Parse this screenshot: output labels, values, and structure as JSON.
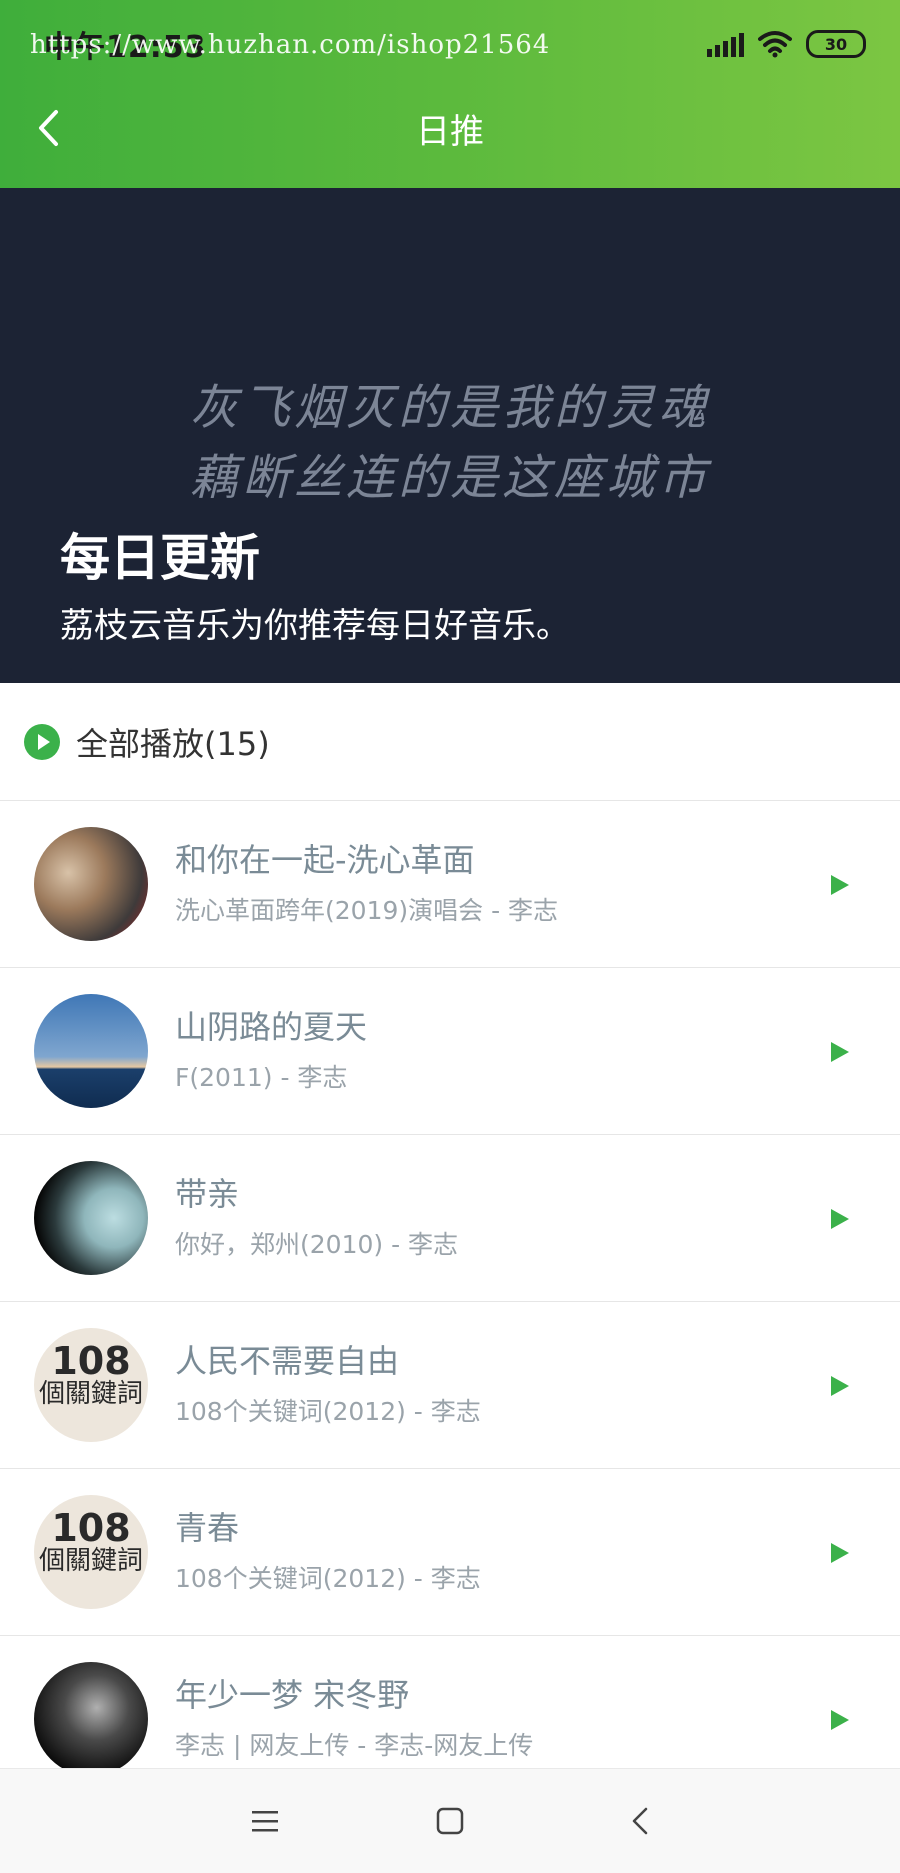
{
  "status_bar": {
    "time": "中午12:53",
    "watermark": "https://www.huzhan.com/ishop21564",
    "battery": "30",
    "icons": [
      "signal-icon",
      "wifi-icon",
      "battery-icon"
    ]
  },
  "header": {
    "title": "日推",
    "back_icon": "chevron-left-icon"
  },
  "banner": {
    "lyric_line_1": "灰飞烟灭的是我的灵魂",
    "lyric_line_2": "藕断丝连的是这座城市",
    "title": "每日更新",
    "subtitle": "荔枝云音乐为你推荐每日好音乐。"
  },
  "play_all": {
    "label": "全部播放(15)",
    "icon": "play-circle-icon"
  },
  "songs": [
    {
      "title": "和你在一起-洗心革面",
      "meta": "洗心革面跨年(2019)演唱会 - 李志"
    },
    {
      "title": "山阴路的夏天",
      "meta": "F(2011) - 李志"
    },
    {
      "title": "带亲",
      "meta": "你好，郑州(2010) - 李志"
    },
    {
      "title": "人民不需要自由",
      "meta": "108个关键词(2012) - 李志",
      "cover_text": "108",
      "cover_sub": "個關鍵詞"
    },
    {
      "title": "青春",
      "meta": "108个关键词(2012) - 李志",
      "cover_text": "108",
      "cover_sub": "個關鍵詞"
    },
    {
      "title": "年少一梦 宋冬野",
      "meta": "李志 | 网友上传 - 李志-网友上传"
    }
  ],
  "nav": {
    "icons": [
      "menu-icon",
      "home-square-icon",
      "back-triangle-icon"
    ]
  },
  "colors": {
    "header_green_start": "#3fae3b",
    "header_green_end": "#7cc642",
    "banner_bg": "#1c2334",
    "accent_green": "#3bb14a"
  }
}
